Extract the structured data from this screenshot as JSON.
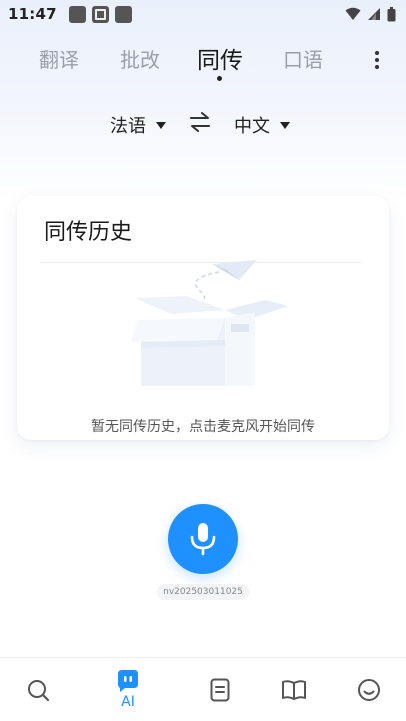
{
  "status_bar": {
    "time": "11:47",
    "icons": [
      "app-square-icon",
      "text-app-icon",
      "app-square-icon",
      "wifi-icon",
      "signal-icon",
      "battery-icon"
    ]
  },
  "top_tabs": [
    {
      "label": "翻译",
      "active": false
    },
    {
      "label": "批改",
      "active": false
    },
    {
      "label": "同传",
      "active": true
    },
    {
      "label": "口语",
      "active": false
    }
  ],
  "language": {
    "source": "法语",
    "target": "中文"
  },
  "history": {
    "title": "同传历史",
    "empty_text": "暂无同传历史，点击麦克风开始同传"
  },
  "device_id": "nv202503011025",
  "bottom_nav": {
    "items": [
      {
        "icon": "search-icon"
      },
      {
        "icon": "ai-robot-icon",
        "label": "AI",
        "active": true
      },
      {
        "icon": "document-icon"
      },
      {
        "icon": "book-icon"
      },
      {
        "icon": "smiley-icon"
      }
    ]
  },
  "colors": {
    "accent": "#1e90ff",
    "inactive_tab": "#9aa0aa",
    "header_bg": "#eaf0fb"
  }
}
